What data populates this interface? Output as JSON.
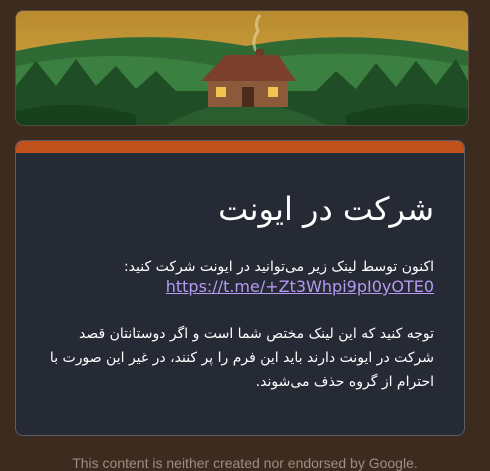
{
  "form": {
    "title": "شرکت در ایونت",
    "intro_text": "اکنون توسط لینک زیر می‌توانید در ایونت شرکت کنید:",
    "link_text": "https://t.me/+Zt3Whpi9pI0yOTE0",
    "notice_text": "توجه کنید که این لینک مختص شما است و اگر دوستانتان قصد شرکت در ایونت دارند باید این فرم را پر کنند، در غیر این صورت با احترام از گروه حذف می‌شوند."
  },
  "footer": {
    "disclaimer": "This content is neither created nor endorsed by Google."
  },
  "colors": {
    "page_bg": "#3e2b1f",
    "card_bg": "#252a35",
    "accent": "#c1521c",
    "link": "#b59af2"
  }
}
